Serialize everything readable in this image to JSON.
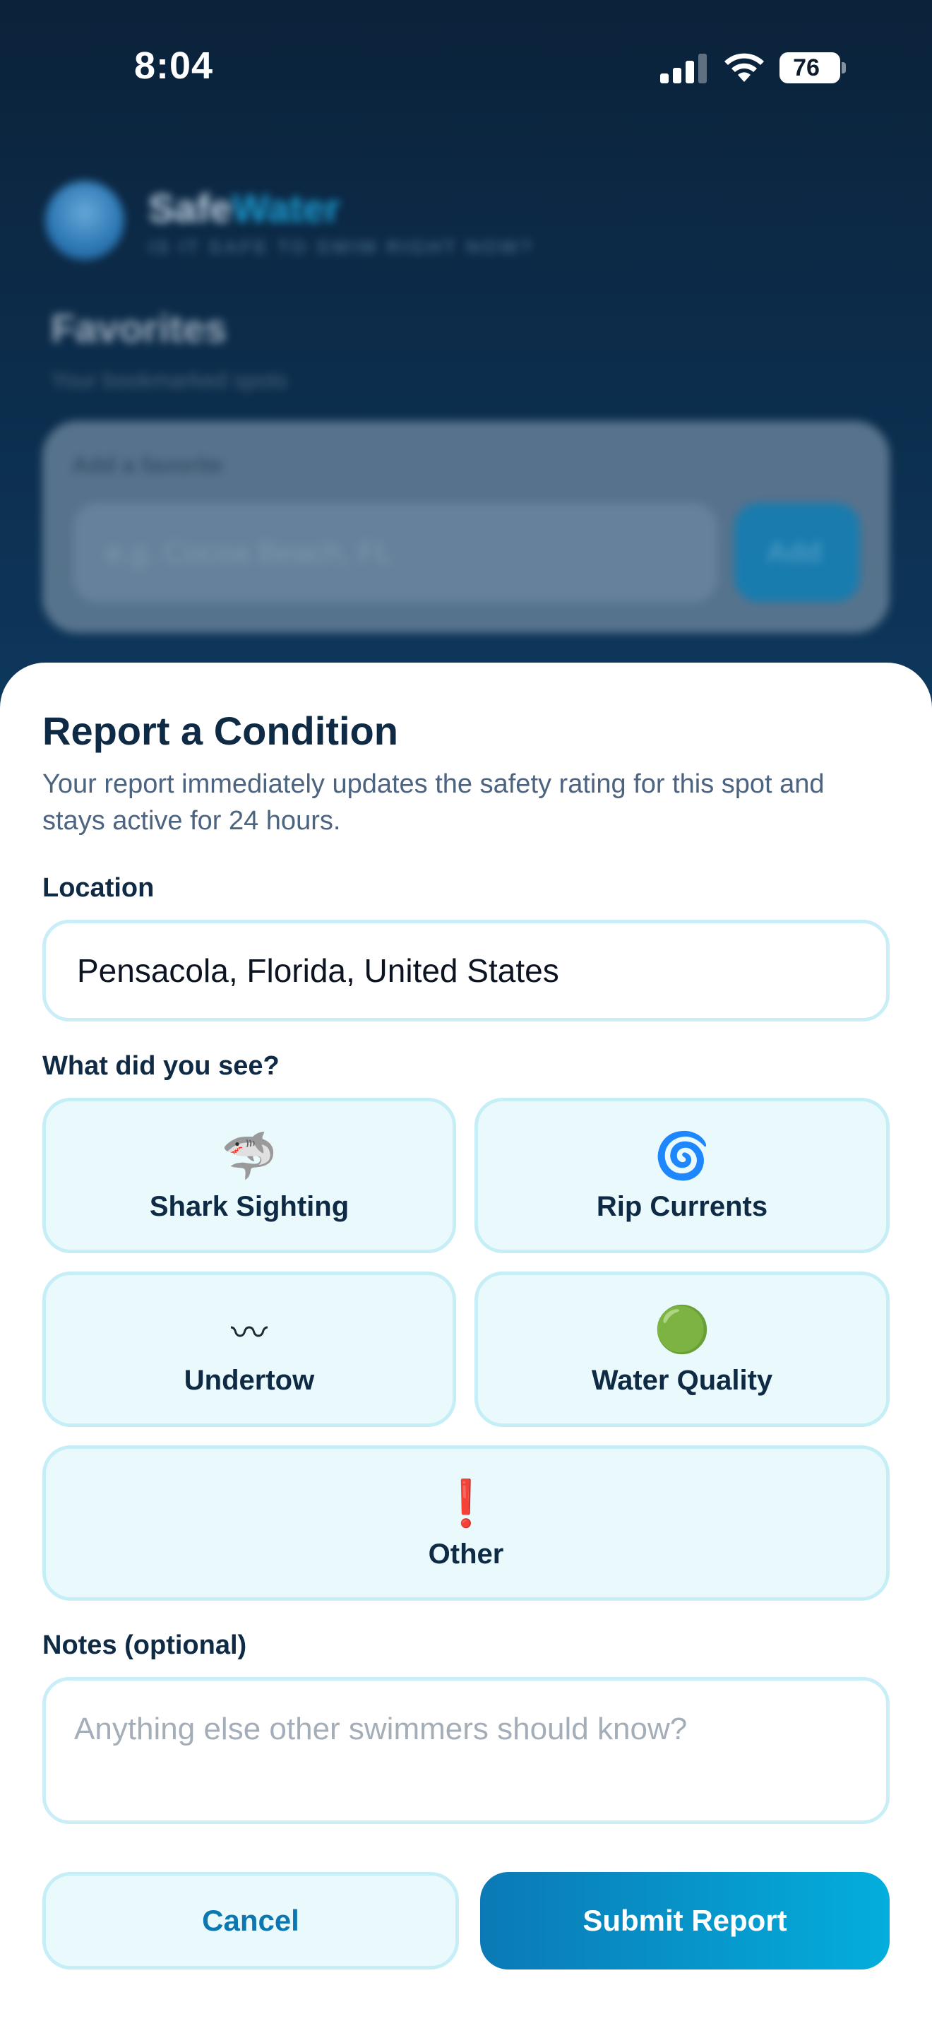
{
  "status_bar": {
    "time": "8:04",
    "battery_percent": "76",
    "signal_bars_active": 3,
    "signal_bars_total": 4,
    "icons": [
      "cellular-signal-icon",
      "wifi-icon",
      "battery-icon"
    ]
  },
  "background_app": {
    "app_name_part1": "Safe",
    "app_name_part2": "Water",
    "tagline": "IS IT SAFE TO SWIM RIGHT NOW?",
    "section_title": "Favorites",
    "section_subtitle": "Your bookmarked spots",
    "add_card_label": "Add a favorite",
    "add_input_placeholder": "e.g. Cocoa Beach, FL",
    "add_button_label": "Add"
  },
  "sheet": {
    "title": "Report a Condition",
    "description": "Your report immediately updates the safety rating for this spot and stays active for 24 hours.",
    "location_label": "Location",
    "location_value": "Pensacola, Florida, United States",
    "conditions_label": "What did you see?",
    "conditions": [
      {
        "label": "Shark Sighting",
        "icon": "shark-icon",
        "glyph": "🦈"
      },
      {
        "label": "Rip Currents",
        "icon": "cyclone-icon",
        "glyph": "🌀"
      },
      {
        "label": "Undertow",
        "icon": "wavy-dash-icon",
        "glyph": "〰"
      },
      {
        "label": "Water Quality",
        "icon": "green-circle-icon",
        "glyph": "🟢"
      },
      {
        "label": "Other",
        "icon": "exclamation-icon",
        "glyph": "❗"
      }
    ],
    "notes_label": "Notes (optional)",
    "notes_placeholder": "Anything else other swimmers should know?",
    "cancel_label": "Cancel",
    "submit_label": "Submit Report"
  },
  "colors": {
    "title_text": "#0f2a44",
    "body_text": "#4c6480",
    "chip_background": "#e9f9fc",
    "chip_border": "#c6eef7",
    "cancel_text": "#0c77b0",
    "submit_gradient_start": "#0b79b5",
    "submit_gradient_end": "#03aedc"
  }
}
